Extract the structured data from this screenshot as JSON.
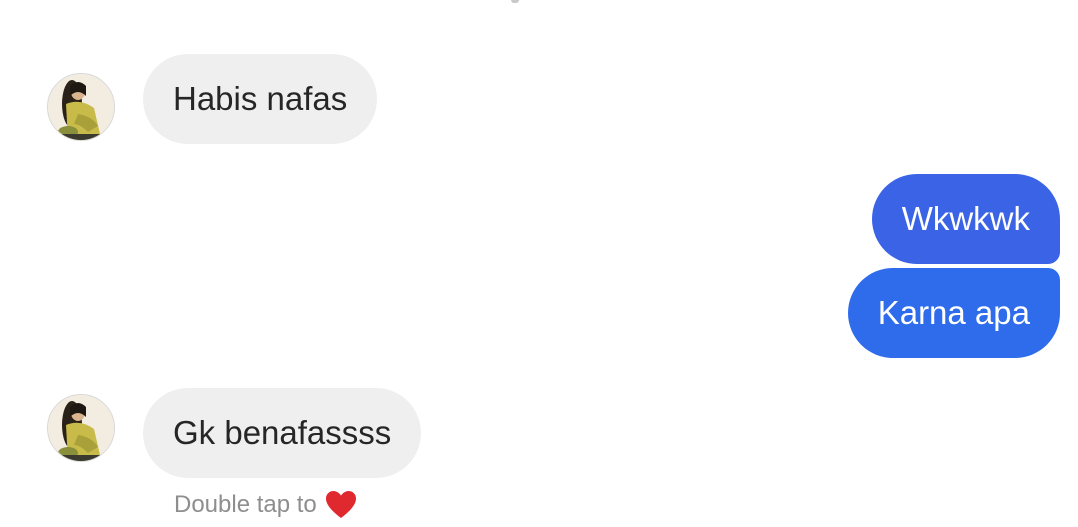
{
  "messages": [
    {
      "direction": "incoming",
      "text": "Habis nafas"
    },
    {
      "direction": "outgoing",
      "text": "Wkwkwk"
    },
    {
      "direction": "outgoing",
      "text": "Karna apa"
    },
    {
      "direction": "incoming",
      "text": "Gk benafassss"
    }
  ],
  "hint": {
    "text": "Double tap to",
    "icon": "heart-icon"
  },
  "colors": {
    "incoming_bubble": "#efefef",
    "incoming_text": "#262626",
    "outgoing_bubble_1": "#3a63e6",
    "outgoing_bubble_2": "#2f6ceb",
    "outgoing_text": "#ffffff",
    "hint_text": "#8e8e8e",
    "heart": "#e0282f"
  }
}
